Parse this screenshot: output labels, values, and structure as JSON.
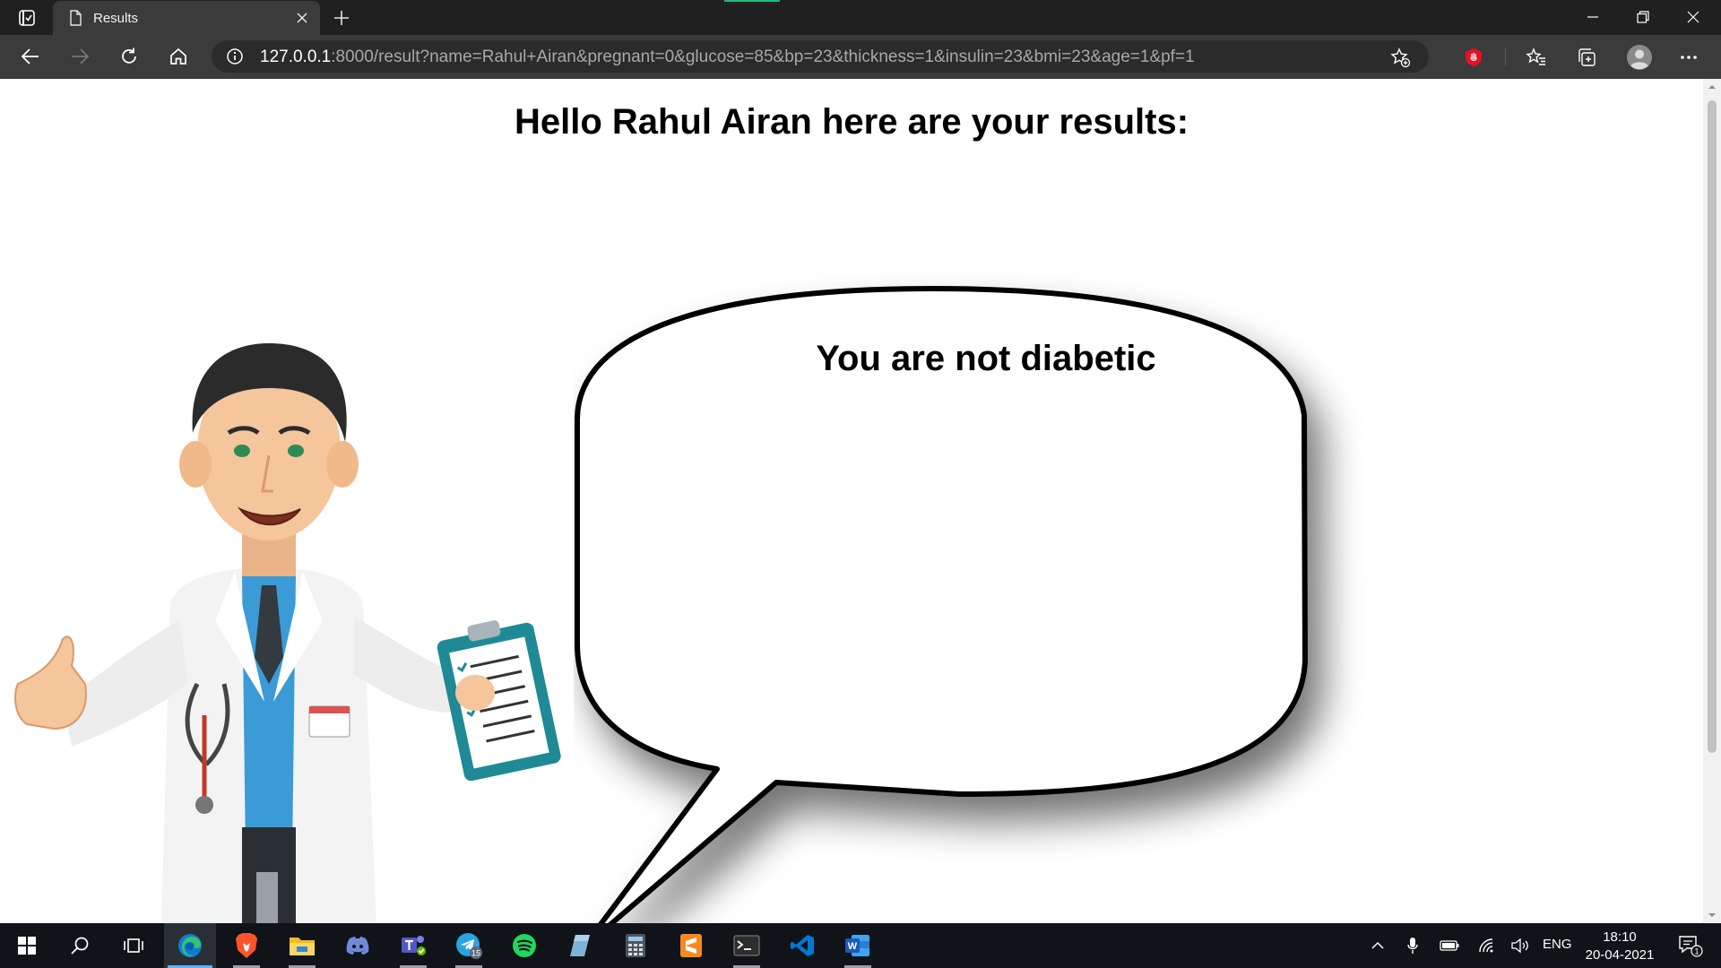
{
  "browser": {
    "tab": {
      "title": "Results"
    },
    "address": {
      "host": "127.0.0.1",
      "rest": ":8000/result?name=Rahul+Airan&pregnant=0&glucose=85&bp=23&thickness=1&insulin=23&bmi=23&age=1&pf=1"
    },
    "icons": {
      "tab_actions": "tab-actions-icon",
      "back": "back-arrow-icon",
      "forward": "forward-arrow-icon",
      "refresh": "refresh-icon",
      "home": "home-icon",
      "info": "info-icon",
      "add_favorite": "star-plus-icon",
      "extension": "adblock-extension-icon",
      "favorites": "favorites-icon",
      "collections": "collections-icon",
      "profile": "profile-avatar-icon",
      "more": "more-dots-icon"
    }
  },
  "page": {
    "heading": "Hello Rahul Airan here are your results:",
    "result": "You are not diabetic",
    "images": {
      "doctor": "doctor-illustration",
      "bubble": "speech-bubble"
    }
  },
  "taskbar": {
    "apps": [
      "start",
      "search",
      "task-view",
      "edge",
      "brave",
      "file-explorer",
      "discord",
      "teams",
      "telegram",
      "spotify",
      "notes",
      "calculator",
      "sublime-text",
      "terminal",
      "vscode",
      "word"
    ],
    "telegram_badge": "15",
    "language": "ENG",
    "time": "18:10",
    "date": "20-04-2021",
    "notification_count": "1"
  },
  "colors": {
    "chrome_dark": "#202020",
    "chrome_bar": "#3b3b3b",
    "accent_green": "#1fb978",
    "taskbar": "#101418"
  }
}
